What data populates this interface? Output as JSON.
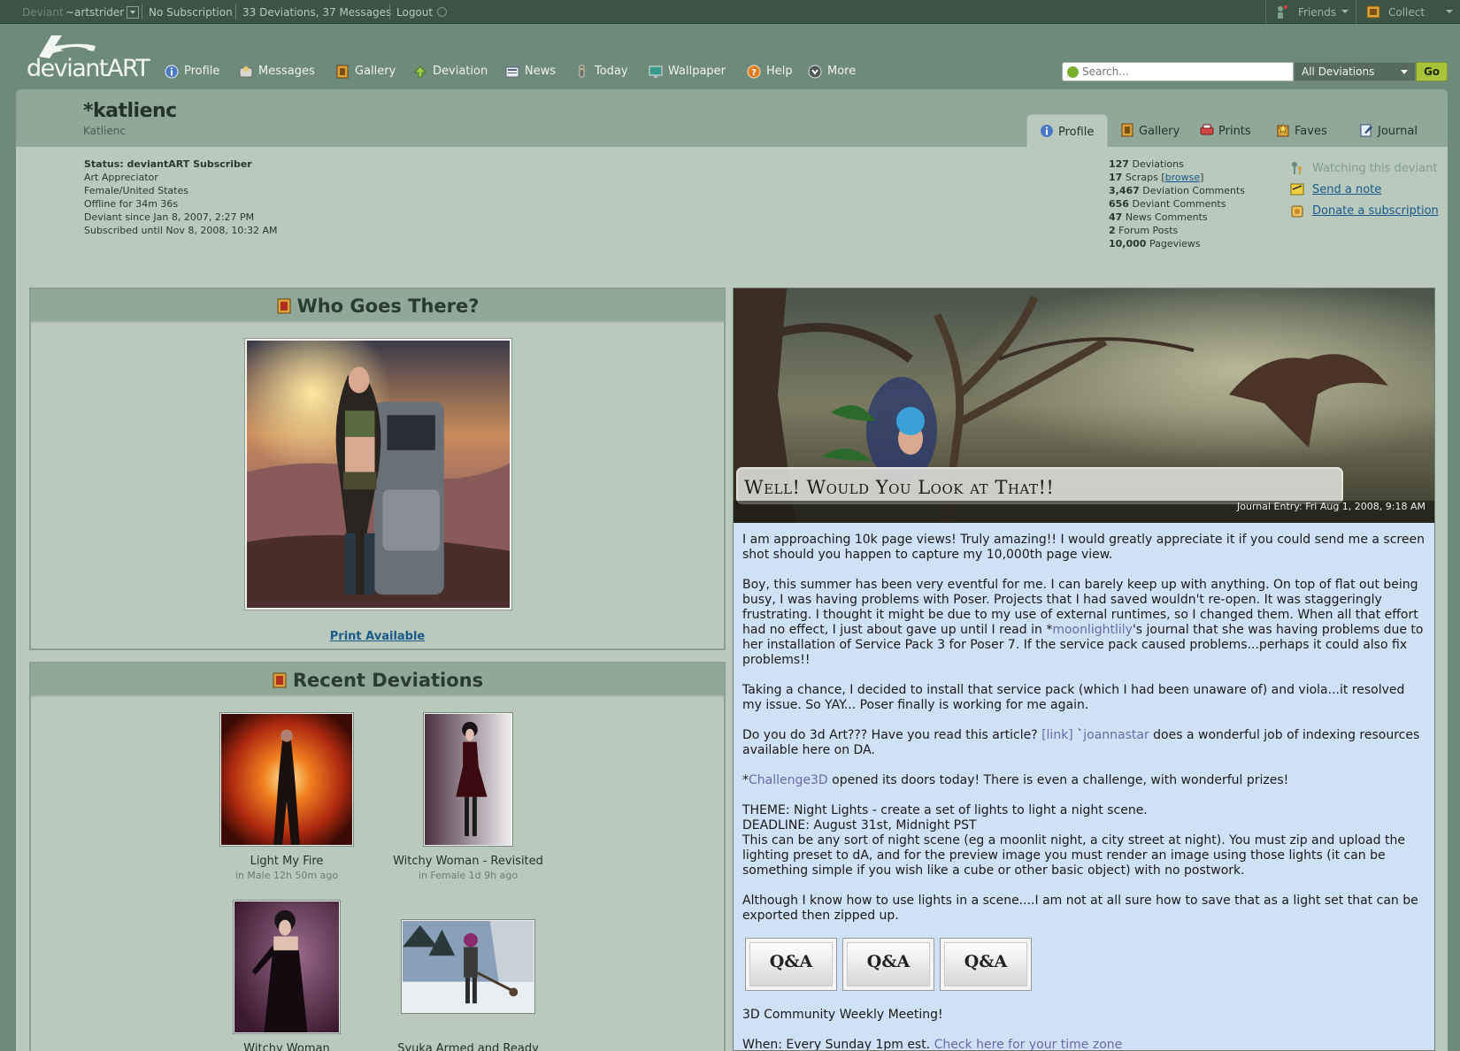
{
  "topbar": {
    "deviant_label": "Deviant",
    "username": "~artstrider",
    "subscription": "No Subscription",
    "counts": "33 Deviations, 37 Messages",
    "logout": "Logout",
    "friends": "Friends",
    "collect": "Collect"
  },
  "logo": {
    "text": "deviantART"
  },
  "nav": {
    "items": [
      {
        "label": "Profile",
        "icon": "info-icon"
      },
      {
        "label": "Messages",
        "icon": "messages-icon"
      },
      {
        "label": "Gallery",
        "icon": "gallery-icon"
      },
      {
        "label": "Deviation",
        "icon": "upload-arrow-icon"
      },
      {
        "label": "News",
        "icon": "news-icon"
      },
      {
        "label": "Today",
        "icon": "today-icon"
      },
      {
        "label": "Wallpaper",
        "icon": "monitor-icon"
      },
      {
        "label": "Help",
        "icon": "help-icon"
      },
      {
        "label": "More",
        "icon": "more-icon"
      }
    ]
  },
  "search": {
    "placeholder": "Search...",
    "scope": "All Deviations",
    "go": "Go"
  },
  "profile": {
    "username": "*katlienc",
    "realname": "Katlienc",
    "tabs": [
      {
        "label": "Profile",
        "active": true
      },
      {
        "label": "Gallery"
      },
      {
        "label": "Prints"
      },
      {
        "label": "Faves"
      },
      {
        "label": "Journal"
      }
    ],
    "status": {
      "line1": "Status: deviantART Subscriber",
      "line2": "Art Appreciator",
      "line3": "Female/United States",
      "line4": "Offline for 34m 36s",
      "line5": "Deviant since Jan 8, 2007, 2:27 PM",
      "line6": "Subscribed until Nov 8, 2008, 10:32 AM"
    },
    "stats": [
      {
        "num": "127",
        "label": "Deviations"
      },
      {
        "num": "17",
        "label": "Scraps",
        "extra": "browse"
      },
      {
        "num": "3,467",
        "label": "Deviation Comments"
      },
      {
        "num": "656",
        "label": "Deviant Comments"
      },
      {
        "num": "47",
        "label": "News Comments"
      },
      {
        "num": "2",
        "label": "Forum Posts"
      },
      {
        "num": "10,000",
        "label": "Pageviews"
      }
    ],
    "actions": {
      "watching": "Watching this deviant",
      "note": "Send a note",
      "donate": "Donate a subscription"
    }
  },
  "who": {
    "title": "Who Goes There?",
    "print": "Print Available"
  },
  "recent": {
    "title": "Recent Deviations",
    "items": [
      {
        "title": "Light My Fire",
        "meta": "in Male 12h 50m ago"
      },
      {
        "title": "Witchy Woman - Revisited",
        "meta": "in Female 1d 9h ago"
      },
      {
        "title": "Witchy Woman",
        "meta": ""
      },
      {
        "title": "Syuka Armed and Ready",
        "meta": ""
      }
    ]
  },
  "journal": {
    "title": "Well! Would You Look at That!!",
    "date": "Journal Entry: Fri Aug 1, 2008, 9:18 AM",
    "p1": "I am approaching 10k page views! Truly amazing!! I would greatly appreciate it if you could send me a screen shot should you happen to capture my 10,000th page view.",
    "p2a": "Boy, this summer has been very eventful for me. I can barely keep up with anything. On top of flat out being busy, I was having problems with Poser. Projects that I had saved wouldn't re-open. It was staggeringly frustrating. I thought it might be due to my use of external runtimes, so I changed them. When all that effort had no effect, I just about gave up until I read in *",
    "p2_link": "moonlightlily",
    "p2b": "'s journal that she was having problems due to her installation of Service Pack 3 for Poser 7. If the service pack caused problems...perhaps it could also fix problems!!",
    "p3": "Taking a chance, I decided to install that service pack (which I had been unaware of) and viola...it resolved my issue. So YAY... Poser finally is working for me again.",
    "p4a": "Do you do 3d Art??? Have you read this article? ",
    "p4_link": "[link]",
    "p4_sep": " `",
    "p4_user": "joannastar",
    "p4b": " does a wonderful job of indexing resources available here on DA.",
    "p5_star": "*",
    "p5_link": "Challenge3D",
    "p5b": " opened its doors today! There is even a challenge, with wonderful prizes!",
    "theme": "THEME: Night Lights - create a set of lights to light a night scene.",
    "deadline": "DEADLINE: August 31st, Midnight PST",
    "p6": "This can be any sort of night scene (eg a moonlit night, a city street at night). You must zip and upload the lighting preset to dA, and for the preview image you must render an image using those lights (it can be something simple if you wish like a cube or other basic object) with no postwork.",
    "p7": "Although I know how to use lights in a scene....I am not at all sure how to save that as a light set that can be exported then zipped up.",
    "qa_label": "Q&A",
    "meeting": "3D Community Weekly Meeting!",
    "when_a": "When: Every Sunday 1pm est. ",
    "when_link": "Check here for your time zone"
  }
}
